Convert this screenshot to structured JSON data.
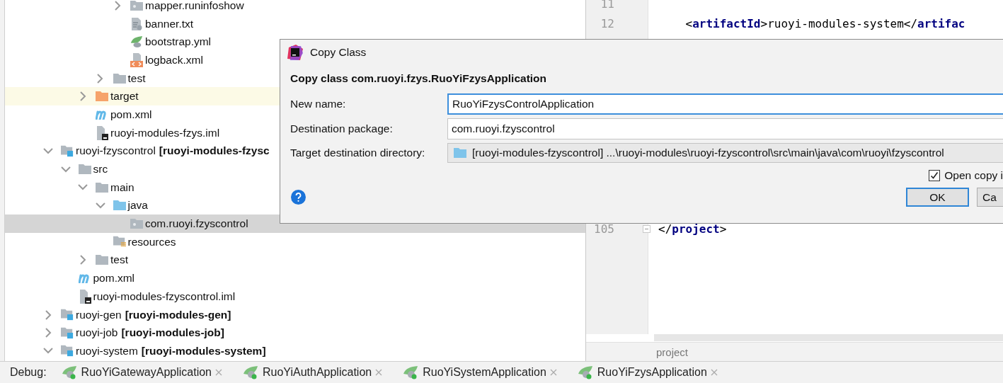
{
  "tree": {
    "rows": [
      {
        "children": [
          {
            "children": [
              {
                "children": [
                  {
                    "children": [
                      {
                        "label": "mapper.runinfoshow",
                        "kind": "package",
                        "expanded": false,
                        "selected": false,
                        "highlighted": false
                      },
                      {
                        "label": "banner.txt",
                        "kind": "text",
                        "selected": false,
                        "highlighted": false
                      },
                      {
                        "label": "bootstrap.yml",
                        "kind": "yml",
                        "selected": false,
                        "highlighted": false
                      },
                      {
                        "label": "logback.xml",
                        "kind": "xml",
                        "selected": false,
                        "highlighted": false
                      }
                    ]
                  },
                  {
                    "label": "test",
                    "kind": "folder",
                    "expanded": false,
                    "selected": false,
                    "highlighted": false
                  }
                ]
              },
              {
                "label": "target",
                "kind": "excluded",
                "expanded": false,
                "selected": false,
                "highlighted": true
              },
              {
                "label": "pom.xml",
                "kind": "maven",
                "selected": false,
                "highlighted": false
              },
              {
                "label": "ruoyi-modules-fzys.iml",
                "kind": "iml",
                "selected": false,
                "highlighted": false
              }
            ]
          }
        ]
      },
      {
        "label": "ruoyi-fzyscontrol",
        "module": "[ruoyi-modules-fzysc",
        "kind": "module",
        "expanded": true,
        "selected": false,
        "highlighted": false,
        "children": [
          {
            "label": "src",
            "kind": "folder",
            "expanded": true,
            "selected": false,
            "highlighted": false,
            "children": [
              {
                "label": "main",
                "kind": "folder",
                "expanded": true,
                "selected": false,
                "highlighted": false,
                "children": [
                  {
                    "label": "java",
                    "kind": "source",
                    "expanded": true,
                    "selected": false,
                    "highlighted": false,
                    "children": [
                      {
                        "label": "com.ruoyi.fzyscontrol",
                        "kind": "package",
                        "selected": true,
                        "highlighted": false
                      }
                    ]
                  },
                  {
                    "label": "resources",
                    "kind": "resources",
                    "selected": false,
                    "highlighted": false
                  }
                ]
              },
              {
                "label": "test",
                "kind": "folder",
                "expanded": false,
                "selected": false,
                "highlighted": false
              }
            ]
          },
          {
            "label": "pom.xml",
            "kind": "maven",
            "selected": false,
            "highlighted": false
          },
          {
            "label": "ruoyi-modules-fzyscontrol.iml",
            "kind": "iml",
            "selected": false,
            "highlighted": false
          }
        ]
      },
      {
        "label": "ruoyi-gen",
        "module": "[ruoyi-modules-gen]",
        "kind": "module",
        "expanded": false,
        "selected": false,
        "highlighted": false
      },
      {
        "label": "ruoyi-job",
        "module": "[ruoyi-modules-job]",
        "kind": "module",
        "expanded": false,
        "selected": false,
        "highlighted": false
      },
      {
        "label": "ruoyi-system",
        "module": "[ruoyi-modules-system]",
        "kind": "module",
        "expanded": true,
        "selected": false,
        "highlighted": false
      }
    ]
  },
  "editor": {
    "line_groups": [
      {
        "lines": [
          {
            "number": "11"
          },
          {
            "number": "12",
            "code": "    <**artifactId**>ruoyi-modules-system</**artifac**"
          }
        ]
      },
      {
        "lines": [
          {
            "number": "105",
            "code": "</**project**>",
            "fold": true
          }
        ]
      }
    ],
    "breadcrumb": "project"
  },
  "dialog": {
    "title": "Copy Class",
    "heading": "Copy class com.ruoyi.fzys.RuoYiFzysApplication",
    "fields": [
      {
        "label": "New name:",
        "value": "RuoYiFzysControlApplication",
        "kind": "text",
        "focused": true
      },
      {
        "label": "Destination package:",
        "value": "com.ruoyi.fzyscontrol",
        "kind": "text",
        "focused": false
      },
      {
        "label": "Target destination directory:",
        "value": "[ruoyi-modules-fzyscontrol] ...\\ruoyi-modules\\ruoyi-fzyscontrol\\src\\main\\java\\com\\ruoyi\\fzyscontrol",
        "kind": "directory"
      }
    ],
    "checkbox": {
      "label": "Open copy i",
      "checked": true
    },
    "buttons": [
      {
        "label": "OK",
        "default": true
      },
      {
        "label": "Ca",
        "default": false
      }
    ]
  },
  "debug": {
    "label": "Debug:",
    "tabs": [
      "RuoYiGatewayApplication",
      "RuoYiAuthApplication",
      "RuoYiSystemApplication",
      "RuoYiFzysApplication"
    ]
  }
}
